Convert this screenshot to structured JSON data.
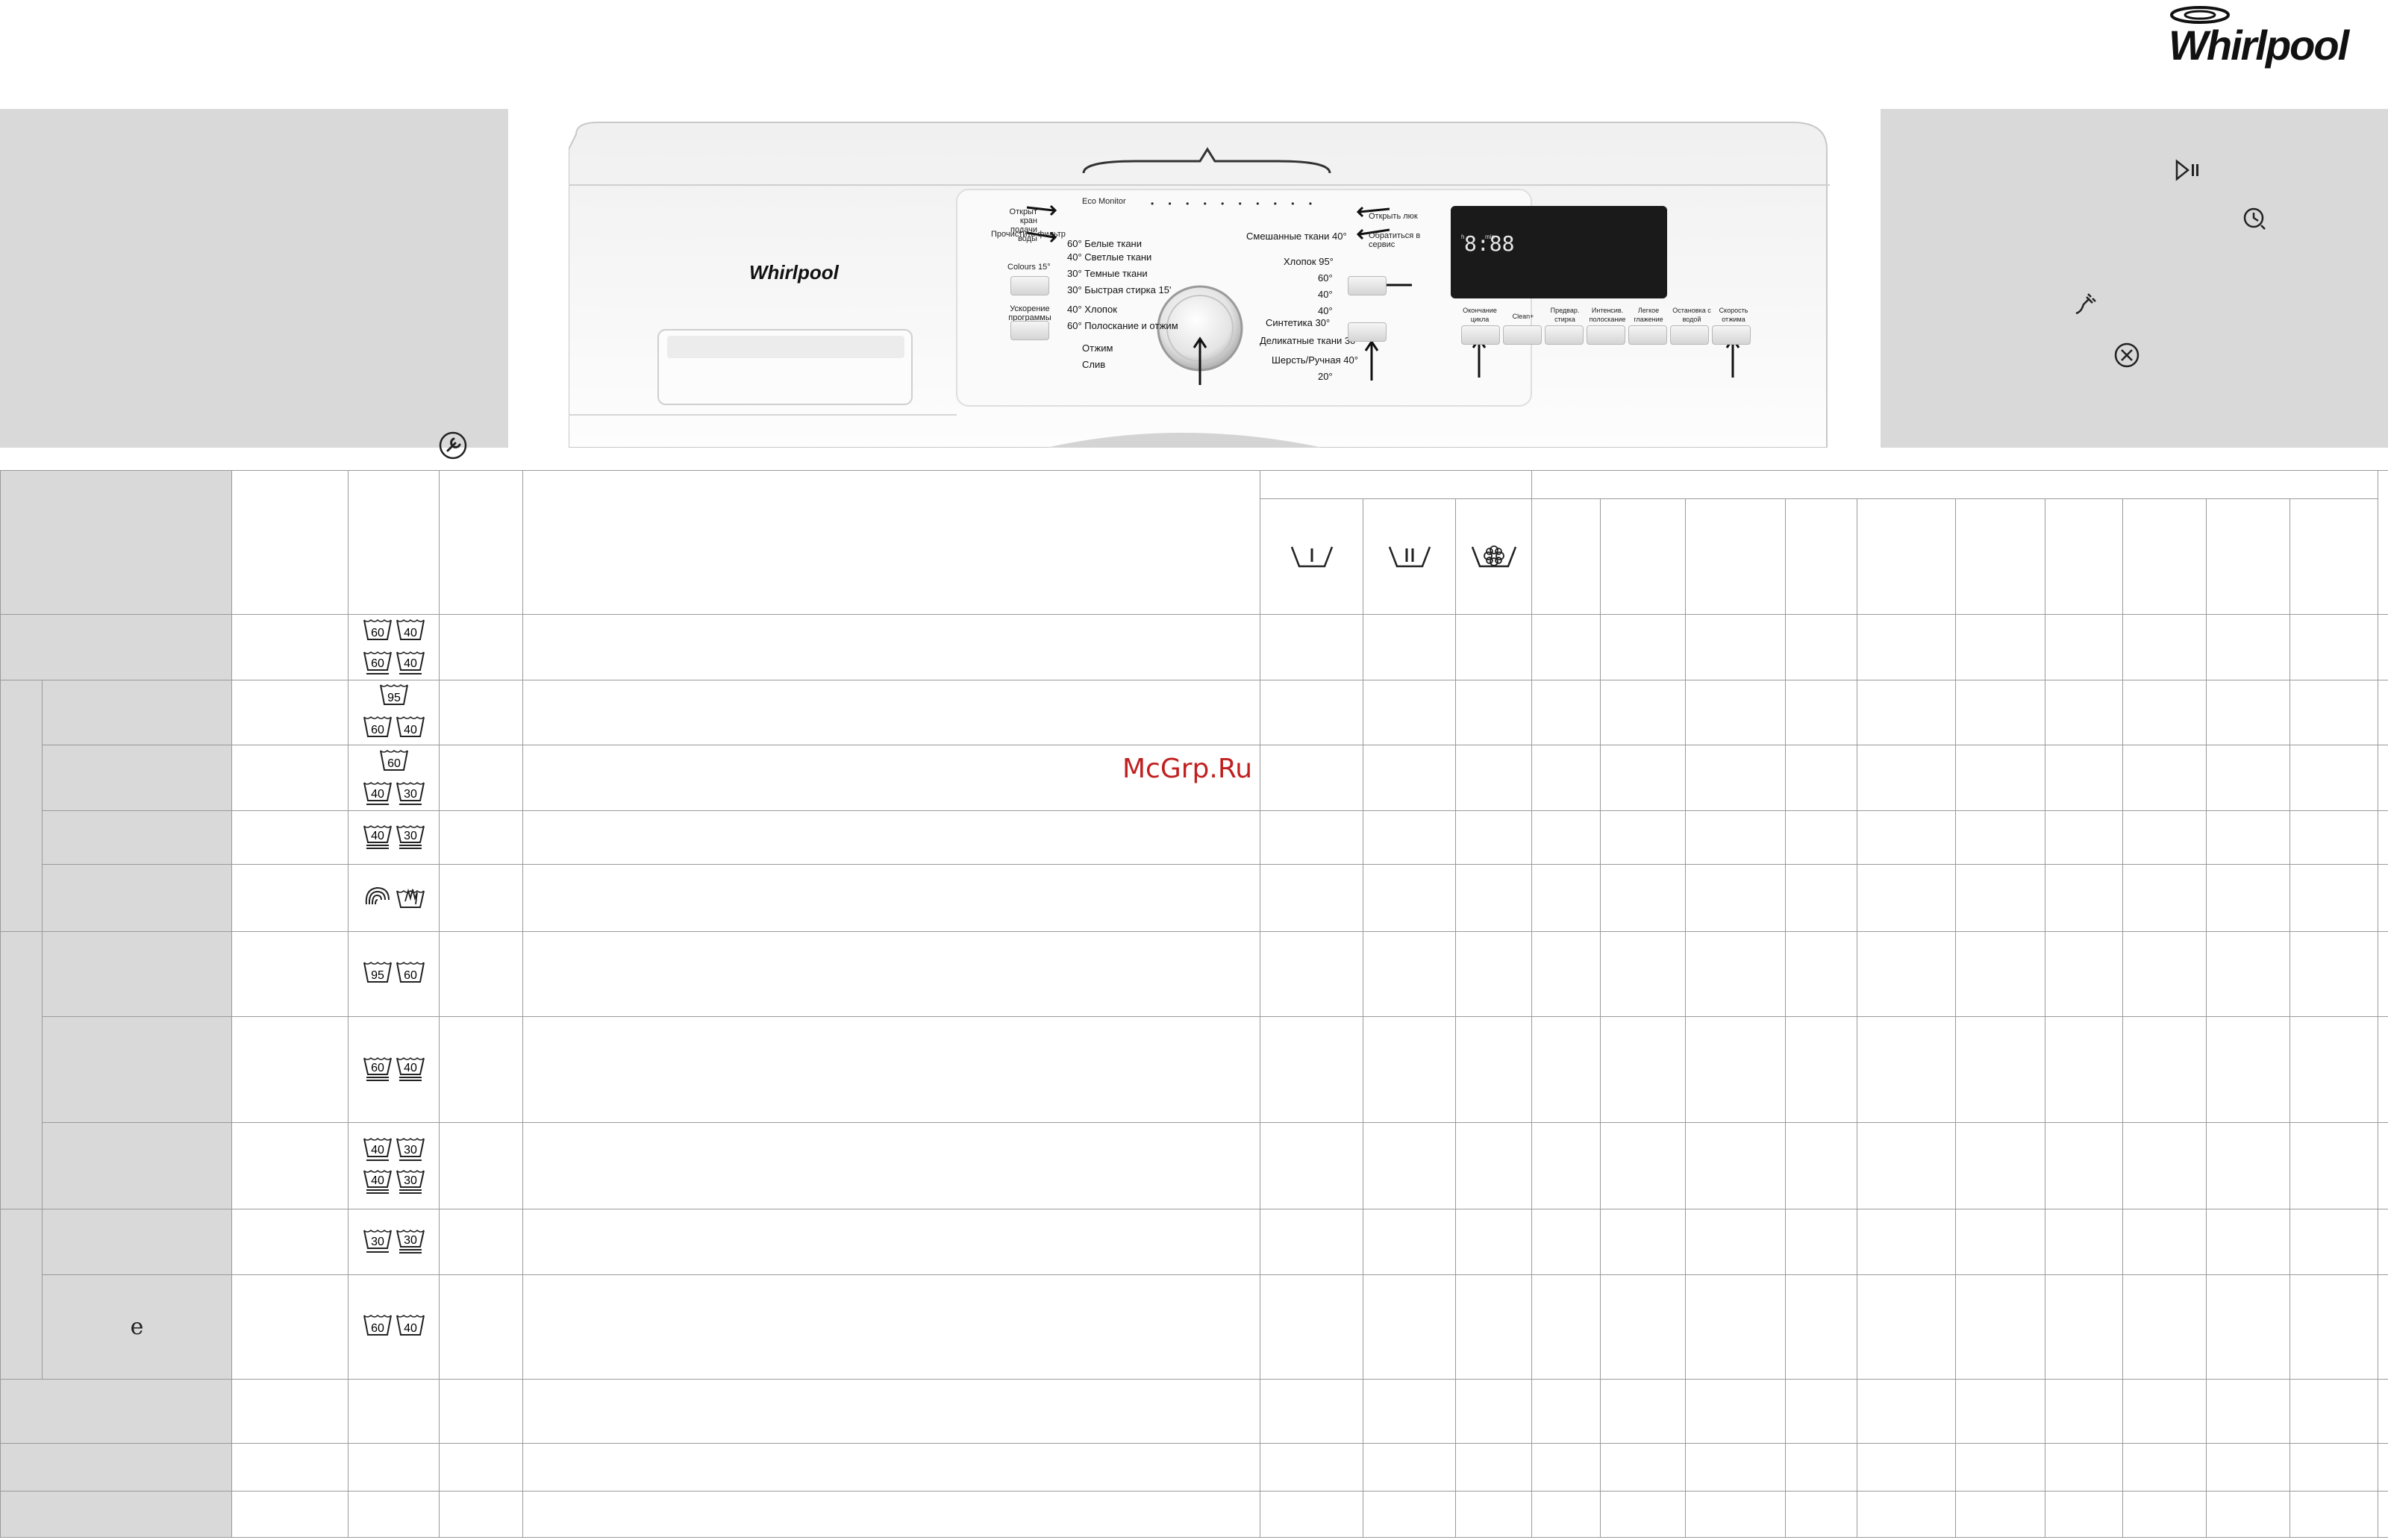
{
  "brand": {
    "name": "Whirlpool"
  },
  "panel": {
    "eco_monitor": "Eco Monitor",
    "left_labels": [
      "Открыт кран подачи воды",
      "Прочистить фильтр"
    ],
    "right_labels": [
      "Открыть люк",
      "Обратиться в сервис"
    ],
    "colours_button": "Colours 15°",
    "speed_button": "Ускорение программы",
    "programs_left": [
      {
        "temp": "60°",
        "name": "Белые ткани"
      },
      {
        "temp": "40°",
        "name": "Светлые ткани"
      },
      {
        "temp": "30°",
        "name": "Темные ткани"
      },
      {
        "temp": "30°",
        "name": "Быстрая стирка 15'"
      },
      {
        "temp": "40°",
        "name": "Хлопок"
      },
      {
        "temp": "60°",
        "name": "Полоскание и отжим"
      },
      {
        "temp": "",
        "name": "Отжим"
      },
      {
        "temp": "",
        "name": "Слив"
      }
    ],
    "programs_right": [
      {
        "name": "Смешанные ткани",
        "temp": "40°"
      },
      {
        "name": "Хлопок",
        "temp": "95°"
      },
      {
        "name": "",
        "temp": "60°"
      },
      {
        "name": "",
        "temp": "40°"
      },
      {
        "name": "",
        "temp": "40°"
      },
      {
        "name": "Синтетика",
        "temp": "30°"
      },
      {
        "name": "Деликатные ткани",
        "temp": "30°"
      },
      {
        "name": "Шерсть/Ручная",
        "temp": "40°"
      },
      {
        "name": "",
        "temp": "20°"
      }
    ],
    "option_buttons": [
      "Окончание цикла",
      "Clean+",
      "Предвар. стирка",
      "Интенсив. полоскание",
      "Легкое глажение",
      "Остановка с водой",
      "Скорость отжима"
    ],
    "display_digits": "8:88",
    "display_units": [
      "h",
      "min"
    ]
  },
  "table": {
    "care_labels": [
      [
        "60",
        "40",
        "60",
        "40"
      ],
      [
        "95",
        "60",
        "40"
      ],
      [
        "60",
        "40",
        "30"
      ],
      [
        "40",
        "30"
      ],
      [
        "wool",
        "hand"
      ],
      [
        "95",
        "60"
      ],
      [
        "60",
        "40"
      ],
      [
        "40",
        "30",
        "40",
        "30"
      ],
      [
        "30",
        "30"
      ],
      [
        "60",
        "40"
      ]
    ],
    "eco_symbol": "e"
  },
  "watermark": "McGrp.Ru",
  "icons": [
    "wrench-icon",
    "play-pause-icon",
    "clock-icon",
    "plug-icon",
    "cancel-icon"
  ]
}
